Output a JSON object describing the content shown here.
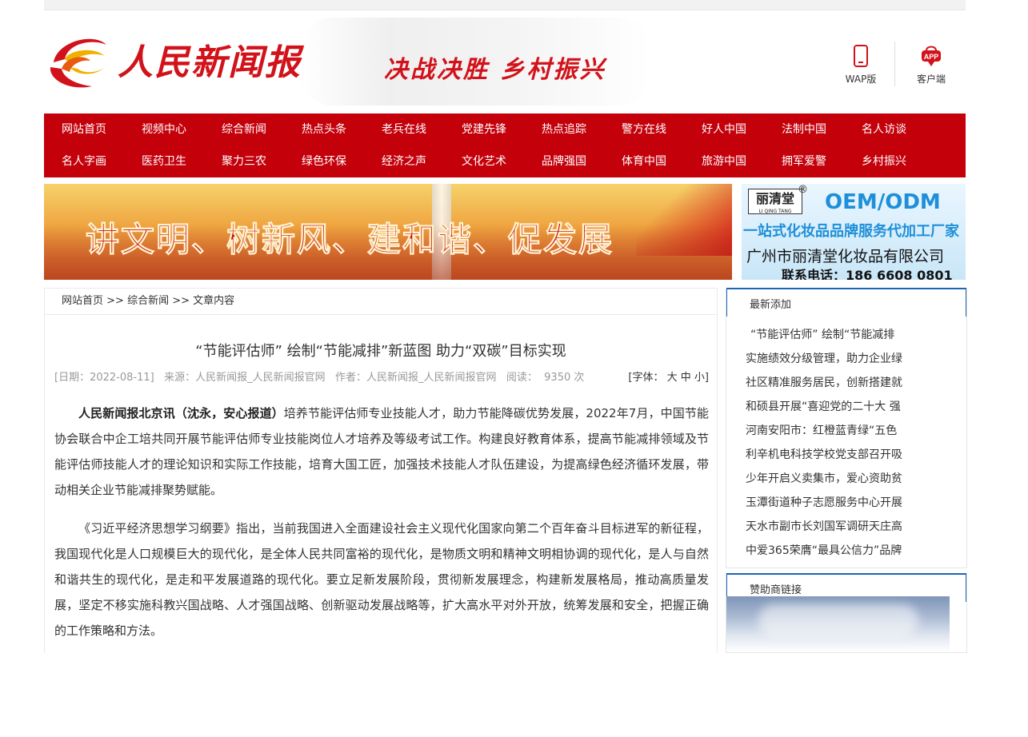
{
  "header": {
    "logo_text": "人民新闻报",
    "slogan": "决战决胜 乡村振兴",
    "wap_label": "WAP版",
    "app_label": "客户端",
    "app_badge": "APP"
  },
  "nav": {
    "row1": [
      "网站首页",
      "视频中心",
      "综合新闻",
      "热点头条",
      "老兵在线",
      "党建先锋",
      "热点追踪",
      "警方在线",
      "好人中国",
      "法制中国",
      "名人访谈"
    ],
    "row2": [
      "名人字画",
      "医药卫生",
      "聚力三农",
      "绿色环保",
      "经济之声",
      "文化艺术",
      "品牌强国",
      "体育中国",
      "旅游中国",
      "拥军爱警",
      "乡村振兴"
    ]
  },
  "banners": {
    "left_text": "讲文明、树新风、建和谐、促发展",
    "right_brand": "丽清堂",
    "right_brand_pinyin": "LI QING TANG",
    "right_reg": "®",
    "right_oem": "OEM/ODM",
    "right_line1": "一站式化妆品品牌服务代加工厂家",
    "right_line2": "广州市丽清堂化妆品有限公司",
    "right_line3": "联系电话：186 6608 0801"
  },
  "breadcrumb": {
    "home": "网站首页",
    "sep1": " >> ",
    "section": "综合新闻",
    "sep2": " >> ",
    "current": "文章内容"
  },
  "article": {
    "title": "“节能评估师” 绘制“节能减排”新蓝图 助力“双碳”目标实现",
    "meta_text": "[日期：2022-08-11]   来源：人民新闻报_人民新闻报官网   作者：人民新闻报_人民新闻报官网   阅读：  9350 次",
    "fs_label": "[字体：",
    "fs_large": "大",
    "fs_medium": "中",
    "fs_small": "小",
    "fs_end": "]",
    "p1_lead": "人民新闻报北京讯（沈永，安心报道）",
    "p1_body": "培养节能评估师专业技能人才，助力节能降碳优势发展，2022年7月，中国节能协会联合中企工培共同开展节能评估师专业技能岗位人才培养及等级考试工作。构建良好教育体系，提高节能减排领域及节能评估师技能人才的理论知识和实际工作技能，培育大国工匠，加强技术技能人才队伍建设，为提高绿色经济循环发展，带动相关企业节能减排聚势赋能。",
    "p2": "《习近平经济思想学习纲要》指出，当前我国进入全面建设社会主义现代化国家向第二个百年奋斗目标进军的新征程，我国现代化是人口规模巨大的现代化，是全体人民共同富裕的现代化，是物质文明和精神文明相协调的现代化，是人与自然和谐共生的现代化，是走和平发展道路的现代化。要立足新发展阶段，贯彻新发展理念，构建新发展格局，推动高质量发展，坚定不移实施科教兴国战略、人才强国战略、创新驱动发展战略等，扩大高水平对外开放，统筹发展和安全，把握正确的工作策略和方法。"
  },
  "sidebar": {
    "latest_title": "最新添加",
    "latest": [
      "“节能评估师” 绘制“节能减排",
      "实施绩效分级管理，助力企业绿",
      "社区精准服务居民，创新搭建就",
      "和硕县开展“喜迎党的二十大 强",
      "河南安阳市：红橙蓝青绿“五色",
      "利辛机电科技学校党支部召开吸",
      "少年开启义卖集市，爱心资助贫",
      "玉潭街道种子志愿服务中心开展",
      "天水市副市长刘国军调研天庄高",
      "中爱365荣膺“最具公信力”品牌"
    ],
    "sponsor_title": "赞助商链接"
  },
  "colors": {
    "brand_red": "#c4000b",
    "logo_red": "#d2121a",
    "side_blue": "#1f63b5"
  }
}
